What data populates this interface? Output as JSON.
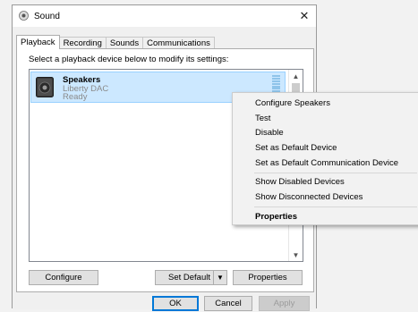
{
  "window": {
    "title": "Sound"
  },
  "tabs": [
    "Playback",
    "Recording",
    "Sounds",
    "Communications"
  ],
  "instruction": "Select a playback device below to modify its settings:",
  "device": {
    "name": "Speakers",
    "description": "Liberty DAC",
    "status": "Ready"
  },
  "buttons": {
    "configure": "Configure",
    "set_default": "Set Default",
    "properties": "Properties",
    "ok": "OK",
    "cancel": "Cancel",
    "apply": "Apply"
  },
  "context_menu": {
    "items": [
      "Configure Speakers",
      "Test",
      "Disable",
      "Set as Default Device",
      "Set as Default Communication Device",
      "Show Disabled Devices",
      "Show Disconnected Devices",
      "Properties"
    ]
  },
  "icons": {
    "window": "speaker-icon",
    "close": "close-icon",
    "device": "speaker-device-icon",
    "dropdown": "chevron-down-icon"
  },
  "colors": {
    "selection": "#cce8ff",
    "accent": "#0078d7"
  }
}
